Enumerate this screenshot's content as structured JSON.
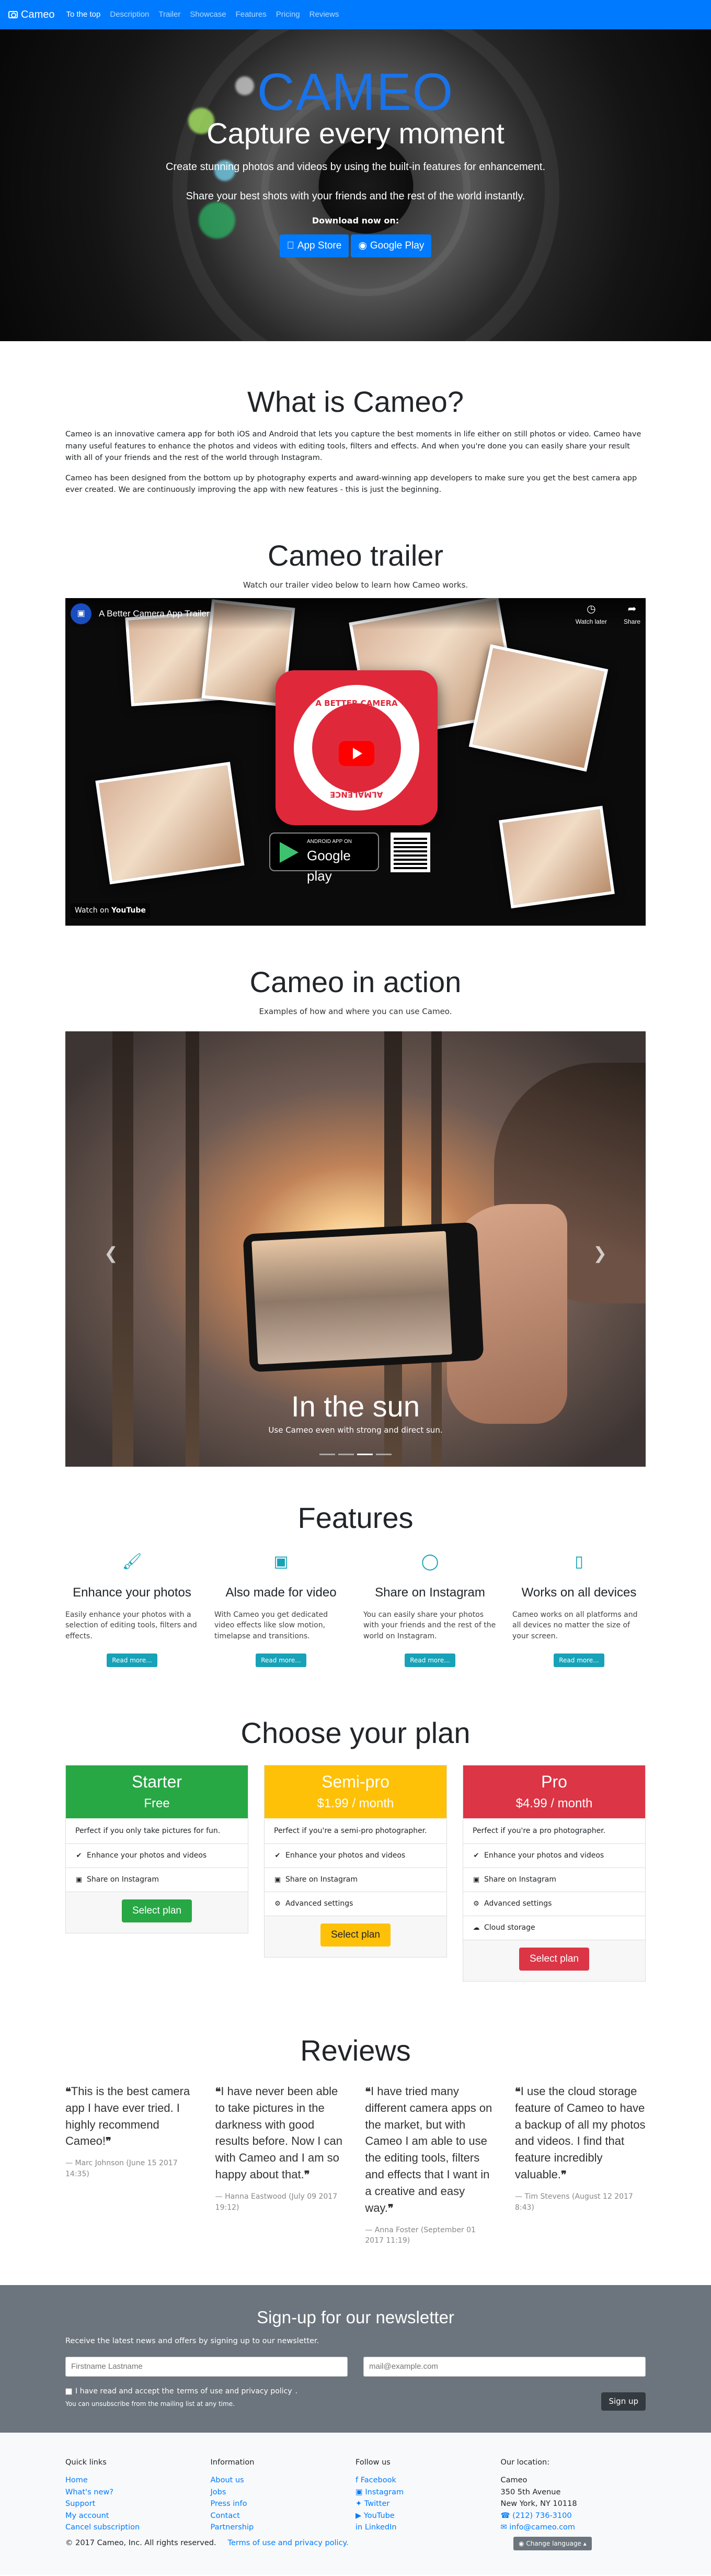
{
  "nav": {
    "brand": "Cameo",
    "links": [
      "To the top",
      "Description",
      "Trailer",
      "Showcase",
      "Features",
      "Pricing",
      "Reviews"
    ]
  },
  "hero": {
    "brand": "CAMEO",
    "tagline": "Capture every moment",
    "text1": "Create stunning photos and videos by using the built-in features for enhancement.",
    "text2": "Share your best shots with your friends and the rest of the world instantly.",
    "download": "Download now on:",
    "appstore": "App Store",
    "googleplay": "Google Play"
  },
  "about": {
    "title": "What is Cameo?",
    "p1": "Cameo is an innovative camera app for both iOS and Android that lets you capture the best moments in life either on still photos or video. Cameo have many useful features to enhance the photos and videos with editing tools, filters and effects. And when you're done you can easily share your result with all of your friends and the rest of the world through Instagram.",
    "p2": "Cameo has been designed from the bottom up by photography experts and award-winning app developers to make sure you get the best camera app ever created. We are continuously improving the app with new features - this is just the beginning."
  },
  "trailer": {
    "title": "Cameo trailer",
    "sub": "Watch our trailer video below to learn how Cameo works.",
    "video_title": "A Better Camera App Trailer",
    "watch_later": "Watch later",
    "share": "Share",
    "watch_on": "Watch on",
    "youtube": "YouTube",
    "logo_top": "A BETTER CAMERA",
    "logo_bottom": "ALMALENCE",
    "gplay_small": "ANDROID APP ON",
    "gplay_big": "Google play"
  },
  "action": {
    "title": "Cameo in action",
    "sub": "Examples of how and where you can use Cameo.",
    "slide_title": "In the sun",
    "slide_text": "Use Cameo even with strong and direct sun."
  },
  "features": {
    "title": "Features",
    "items": [
      {
        "icon": "paint-brush-icon",
        "title": "Enhance your photos",
        "text": "Easily enhance your photos with a selection of editing tools, filters and effects.",
        "btn": "Read more..."
      },
      {
        "icon": "video-camera-icon",
        "title": "Also made for video",
        "text": "With Cameo you get dedicated video effects like slow motion, timelapse and transitions.",
        "btn": "Read more..."
      },
      {
        "icon": "instagram-icon",
        "title": "Share on Instagram",
        "text": "You can easily share your photos with your friends and the rest of the world on Instagram.",
        "btn": "Read more..."
      },
      {
        "icon": "mobile-icon",
        "title": "Works on all devices",
        "text": "Cameo works on all platforms and all devices no matter the size of your screen.",
        "btn": "Read more..."
      }
    ]
  },
  "plans": {
    "title": "Choose your plan",
    "items": [
      {
        "name": "Starter",
        "price": "Free",
        "color": "#28a745",
        "desc": "Perfect if you only take pictures for fun.",
        "features": [
          "Enhance your photos and videos",
          "Share on Instagram"
        ],
        "btn": "Select plan"
      },
      {
        "name": "Semi-pro",
        "price": "$1.99 / month",
        "color": "#ffc107",
        "desc": "Perfect if you're a semi-pro photographer.",
        "features": [
          "Enhance your photos and videos",
          "Share on Instagram",
          "Advanced settings"
        ],
        "btn": "Select plan"
      },
      {
        "name": "Pro",
        "price": "$4.99 / month",
        "color": "#dc3545",
        "desc": "Perfect if you're a pro photographer.",
        "features": [
          "Enhance your photos and videos",
          "Share on Instagram",
          "Advanced settings",
          "Cloud storage"
        ],
        "btn": "Select plan"
      }
    ]
  },
  "reviews": {
    "title": "Reviews",
    "items": [
      {
        "quote": "This is the best camera app I have ever tried. I highly recommend Cameo!",
        "who": "— Marc Johnson (June 15 2017 14:35)"
      },
      {
        "quote": "I have never been able to take pictures in the darkness with good results before. Now I can with Cameo and I am so happy about that.",
        "who": "— Hanna Eastwood (July 09 2017 19:12)"
      },
      {
        "quote": "I have tried many different camera apps on the market, but with Cameo I am able to use the editing tools, filters and effects that I want in a creative and easy way.",
        "who": "— Anna Foster (September 01 2017 11:19)"
      },
      {
        "quote": "I use the cloud storage feature of Cameo to have a backup of all my photos and videos. I find that feature incredibly valuable.",
        "who": "— Tim Stevens (August 12 2017 8:43)"
      }
    ]
  },
  "newsletter": {
    "title": "Sign-up for our newsletter",
    "lead": "Receive the latest news and offers by signing up to our newsletter.",
    "name_placeholder": "Firstname Lastname",
    "email_placeholder": "mail@example.com",
    "check_text": "I have read and accept the",
    "check_link": "terms of use and privacy policy",
    "small": "You can unsubscribe from the mailing list at any time.",
    "btn": "Sign up"
  },
  "footer": {
    "quick_title": "Quick links",
    "quick": [
      "Home",
      "What's new?",
      "Support",
      "My account",
      "Cancel subscription"
    ],
    "info_title": "Information",
    "info": [
      "About us",
      "Jobs",
      "Press info",
      "Contact",
      "Partnership"
    ],
    "follow_title": "Follow us",
    "follow": [
      "Facebook",
      "Instagram",
      "Twitter",
      "YouTube",
      "LinkedIn"
    ],
    "loc_title": "Our location:",
    "loc_name": "Cameo",
    "loc_street": "350 5th Avenue",
    "loc_city": "New York, NY 10118",
    "phone": "(212) 736-3100",
    "email": "info@cameo.com",
    "copyright": "© 2017 Cameo, Inc.   All rights reserved.",
    "terms": "Terms of use and privacy policy.",
    "lang": "Change language"
  },
  "colors": {
    "primary": "#007bff",
    "info": "#17a2b8",
    "success": "#28a745",
    "warning": "#ffc107",
    "danger": "#dc3545",
    "secondary": "#6c757d"
  }
}
